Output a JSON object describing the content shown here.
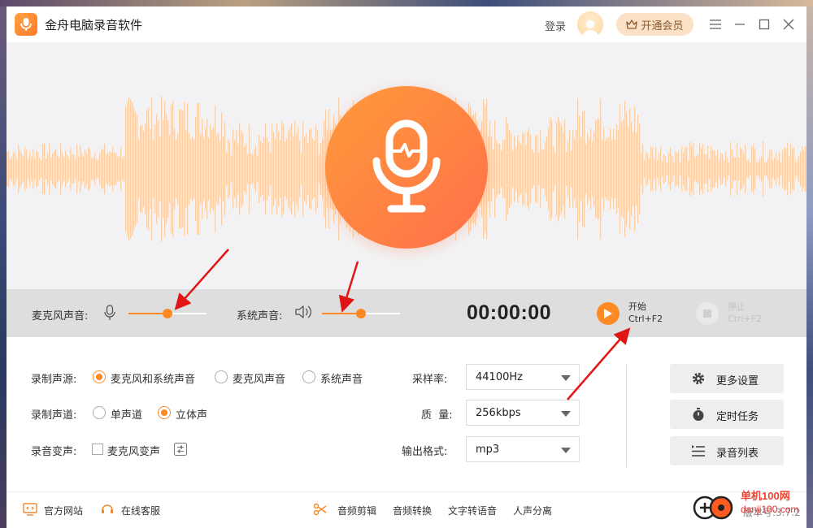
{
  "app": {
    "title": "金舟电脑录音软件",
    "login": "登录",
    "vip_label": "开通会员"
  },
  "colors": {
    "accent": "#ff8a24",
    "control_bar": "#dedede",
    "hero_bg": "#f2f2f4"
  },
  "controls": {
    "mic_label": "麦克风声音:",
    "mic_volume": 0.5,
    "system_label": "系统声音:",
    "system_volume": 0.5,
    "timer": "00:00:00",
    "start_label": "开始",
    "start_shortcut": "Ctrl+F2",
    "stop_label": "停止",
    "stop_shortcut": "Ctrl+F2"
  },
  "settings": {
    "source_label": "录制声源:",
    "source_options": [
      "麦克风和系统声音",
      "麦克风声音",
      "系统声音"
    ],
    "source_selected": 0,
    "channel_label": "录制声道:",
    "channel_options": [
      "单声道",
      "立体声"
    ],
    "channel_selected": 1,
    "voice_change_label": "录音变声:",
    "voice_change_option": "麦克风变声",
    "sample_rate_label": "采样率:",
    "sample_rate_value": "44100Hz",
    "quality_label": "质  量:",
    "quality_value": "256kbps",
    "format_label": "输出格式:",
    "format_value": "mp3"
  },
  "side_buttons": {
    "more_settings": "更多设置",
    "timer_task": "定时任务",
    "record_list": "录音列表"
  },
  "footer": {
    "website": "官方网站",
    "support": "在线客服",
    "audio_cut": "音频剪辑",
    "audio_convert": "音频转换",
    "text_to_speech": "文字转语音",
    "vocal_separation": "人声分离",
    "version": "版本号:3.7.2"
  },
  "watermark": {
    "name": "单机100网",
    "url": "danji100.com"
  }
}
